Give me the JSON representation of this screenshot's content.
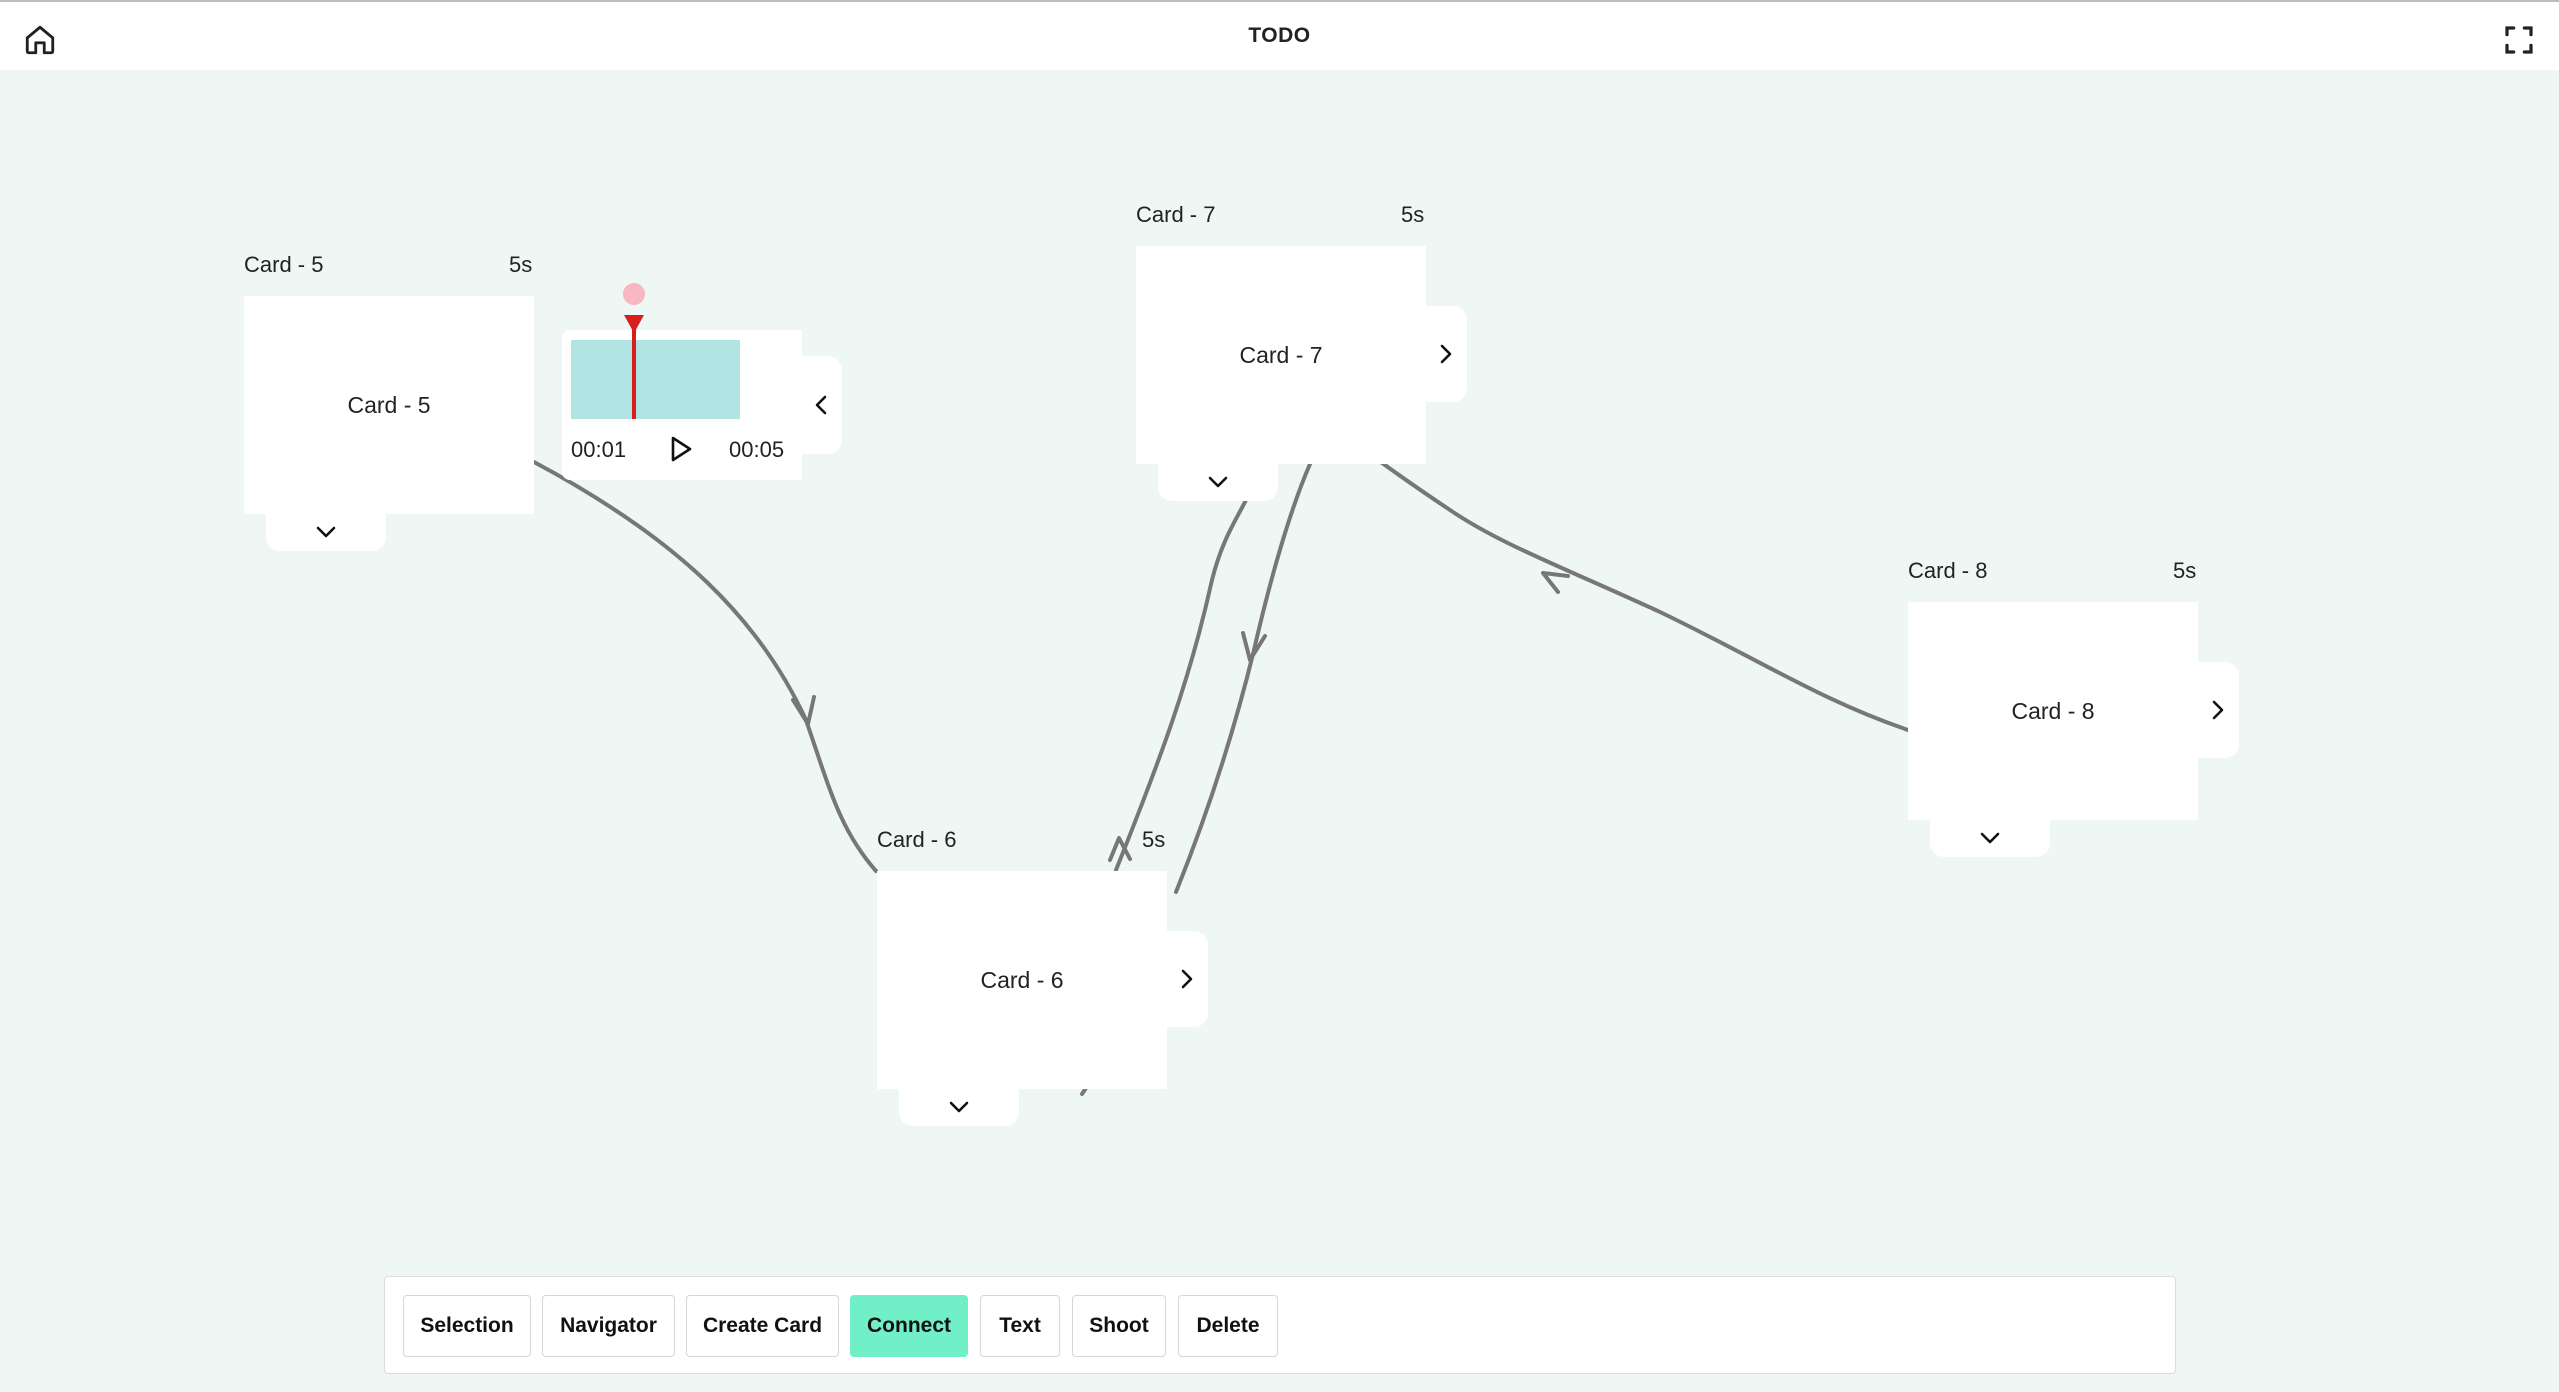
{
  "header": {
    "title": "TODO",
    "home_icon": "home-icon",
    "fullscreen_icon": "fullscreen-icon"
  },
  "cards": [
    {
      "id": "card5",
      "label": "Card - 5",
      "duration": "5s",
      "body": "Card - 5"
    },
    {
      "id": "card6",
      "label": "Card - 6",
      "duration": "5s",
      "body": "Card - 6"
    },
    {
      "id": "card7",
      "label": "Card - 7",
      "duration": "5s",
      "body": "Card - 7"
    },
    {
      "id": "card8",
      "label": "Card - 8",
      "duration": "5s",
      "body": "Card - 8"
    }
  ],
  "player": {
    "current_time": "00:01",
    "total_time": "00:05",
    "progress": 0.2,
    "clip_color": "#b0e5e4",
    "playhead_color": "#d91e1e"
  },
  "toolbar": {
    "buttons": [
      {
        "label": "Selection",
        "active": false
      },
      {
        "label": "Navigator",
        "active": false
      },
      {
        "label": "Create Card",
        "active": false
      },
      {
        "label": "Connect",
        "active": true
      },
      {
        "label": "Text",
        "active": false
      },
      {
        "label": "Shoot",
        "active": false
      },
      {
        "label": "Delete",
        "active": false
      }
    ],
    "active_color": "#71f0c8"
  },
  "connections": [
    {
      "from": "Card - 5",
      "to": "Card - 6"
    },
    {
      "from": "Card - 6",
      "to": "Card - 7"
    },
    {
      "from": "Card - 7",
      "to": "Card - 6"
    },
    {
      "from": "Card - 8",
      "to": "Card - 7"
    }
  ],
  "colors": {
    "canvas_background": "#eff7f5",
    "edge_color": "#777777"
  }
}
